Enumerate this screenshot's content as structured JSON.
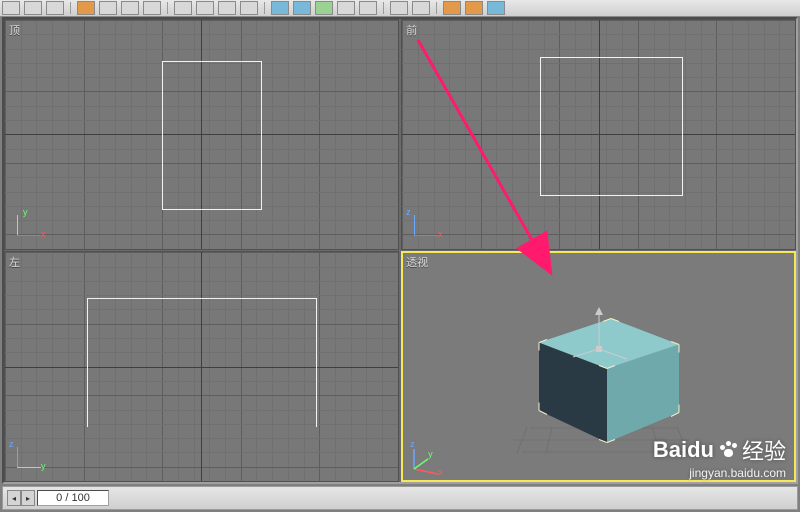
{
  "toolbar": {
    "icons": [
      "undo",
      "redo",
      "link",
      "select",
      "move",
      "rotate",
      "scale",
      "snap",
      "angle",
      "mirror",
      "material",
      "render",
      "align",
      "layer",
      "view",
      "abc"
    ]
  },
  "viewports": {
    "top": {
      "label": "顶"
    },
    "front": {
      "label": "前"
    },
    "left": {
      "label": "左"
    },
    "persp": {
      "label": "透视"
    }
  },
  "axes": {
    "x": "x",
    "y": "y",
    "z": "z"
  },
  "status": {
    "frame_value": "0 / 100",
    "prev": "◂",
    "next": "▸"
  },
  "watermark": {
    "brand": "Bai",
    "brand_accent": "du",
    "cjk": "经验",
    "sub": "jingyan.baidu.com"
  },
  "colors": {
    "active_outline": "#f7e85a",
    "arrow": "#ff1a6e",
    "axis_x": "#ff5a5a",
    "axis_y": "#6cff6c",
    "axis_z": "#6aa8ff",
    "box_top": "#8ec9cc",
    "box_right": "#6fa9ab",
    "box_left": "#2a3a44"
  }
}
